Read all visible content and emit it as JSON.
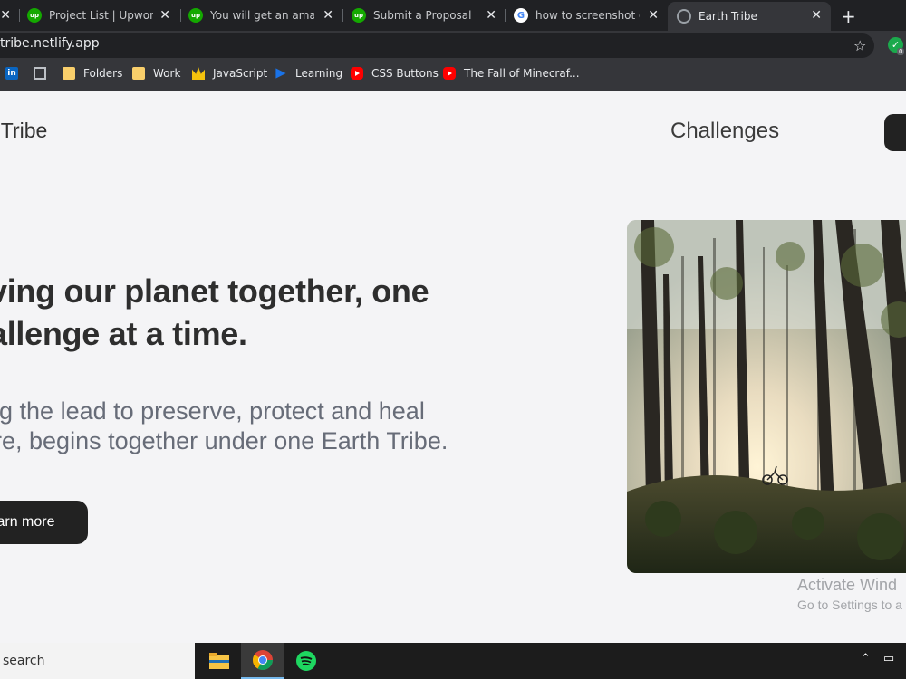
{
  "browser": {
    "tabs": [
      {
        "title": "",
        "favicon": "unknown"
      },
      {
        "title": "Project List | Upwork",
        "favicon": "upwork-icon"
      },
      {
        "title": "You will get an amazing",
        "favicon": "upwork-icon"
      },
      {
        "title": "Submit a Proposal",
        "favicon": "upwork-icon"
      },
      {
        "title": "how to screenshot on",
        "favicon": "google-icon"
      },
      {
        "title": "Earth Tribe",
        "favicon": "globe-icon",
        "active": true
      }
    ],
    "new_tab": "+",
    "url": "tribe.netlify.app",
    "extension_badge": "0",
    "bookmarks": [
      {
        "label": "",
        "icon": "linkedin-icon"
      },
      {
        "label": "",
        "icon": "grid-icon"
      },
      {
        "label": "Folders",
        "icon": "folder-icon"
      },
      {
        "label": "Work",
        "icon": "folder-icon"
      },
      {
        "label": "JavaScript",
        "icon": "crown-icon"
      },
      {
        "label": "Learning",
        "icon": "play-icon"
      },
      {
        "label": "CSS Buttons",
        "icon": "youtube-icon"
      },
      {
        "label": "The Fall of Minecraf...",
        "icon": "youtube-icon"
      }
    ]
  },
  "site": {
    "logo": "nTribe",
    "nav_challenges": "Challenges",
    "headline_line1": "ving our planet together, one",
    "headline_line2": "allenge at a time.",
    "subtext_line1": "ing the lead to preserve, protect and heal",
    "subtext_line2": "ure, begins together under one Earth Tribe.",
    "learn_more": "arn more"
  },
  "watermark": {
    "title": "Activate Wind",
    "subtitle": "Go to Settings to a"
  },
  "taskbar": {
    "search": "search",
    "apps": [
      "file-explorer-icon",
      "chrome-icon",
      "spotify-icon"
    ]
  },
  "colors": {
    "page_bg": "#f4f4f6",
    "button_bg": "#222222",
    "chrome_dark": "#202124",
    "upwork_green": "#14a800"
  }
}
